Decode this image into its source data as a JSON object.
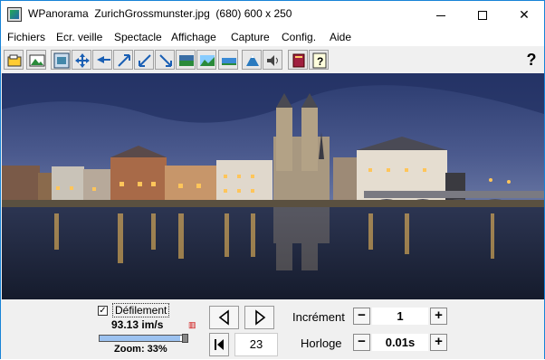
{
  "window": {
    "title": "WPanorama  ZurichGrossmunster.jpg  (680) 600 x 250",
    "min_glyph": "minimize-icon",
    "max_glyph": "maximize-icon",
    "close_glyph": "✕"
  },
  "menu": [
    "Fichiers",
    "Ecr. veille",
    "Spectacle",
    "Affichage",
    "Capture",
    "Config.",
    "Aide"
  ],
  "toolbar": {
    "icons": [
      "open-icon",
      "image-icon",
      "fit-icon",
      "move-icon",
      "shrink-left-icon",
      "expand-icon",
      "shrink-icon",
      "expand-corner-icon",
      "panorama-icon",
      "landscape-icon",
      "flat-icon",
      "mountain-icon",
      "sound-icon",
      "book-icon",
      "info-icon"
    ],
    "help": "?"
  },
  "controls": {
    "scroll_checked": "✓",
    "scroll_label": "Défilement",
    "speed": "93.13 im/s",
    "speed_level": 0.92,
    "zoom": "Zoom: 33%",
    "frame": "23",
    "increment_label": "Incrément",
    "increment_value": "1",
    "clock_label": "Horloge",
    "clock_value": "0.01s",
    "minus": "−",
    "plus": "+"
  },
  "colors": {
    "sky_top": "#2a3a6e",
    "sky_mid": "#4b5a8e",
    "water": "#1a2236",
    "light": "#ffc55a"
  }
}
